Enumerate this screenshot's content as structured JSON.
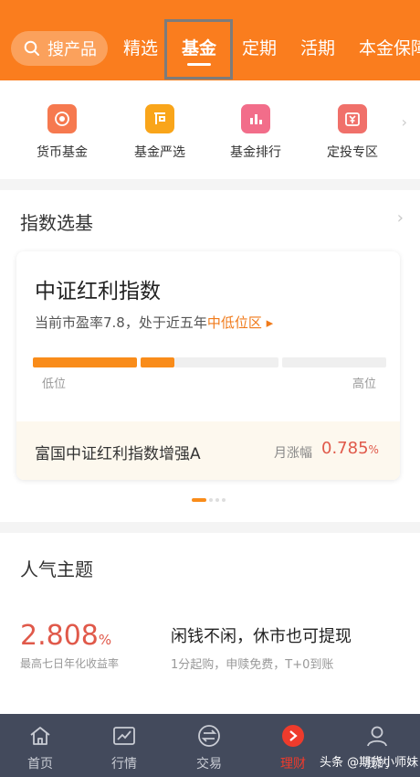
{
  "header": {
    "search_label": "搜产品",
    "tabs": [
      {
        "label": "精选"
      },
      {
        "label": "基金"
      },
      {
        "label": "定期"
      },
      {
        "label": "活期"
      },
      {
        "label": "本金保障"
      }
    ],
    "active_tab": "基金"
  },
  "quick_nav": [
    {
      "label": "货币基金",
      "icon": "target-icon"
    },
    {
      "label": "基金严选",
      "icon": "flag-icon"
    },
    {
      "label": "基金排行",
      "icon": "bar-chart-icon"
    },
    {
      "label": "定投专区",
      "icon": "yuan-calendar-icon"
    }
  ],
  "index_section": {
    "title": "指数选基",
    "card": {
      "title": "中证红利指数",
      "desc_prefix": "当前市盈率7.8，处于近五年",
      "desc_highlight": "中低位区",
      "low_label": "低位",
      "high_label": "高位",
      "valuation_position_fraction": 0.4,
      "fund_name": "富国中证红利指数增强A",
      "metric_label": "月涨幅",
      "metric_value": "0.785",
      "metric_unit": "%"
    },
    "pager": {
      "count": 4,
      "active_index": 0
    }
  },
  "popular_section": {
    "title": "人气主题",
    "value": "2.808",
    "value_unit": "%",
    "value_label": "最高七日年化收益率",
    "headline": "闲钱不闲，休市也可提现",
    "subline": "1分起购，申赎免费，T+0到账"
  },
  "bottom_nav": [
    {
      "label": "首页",
      "icon": "home-icon"
    },
    {
      "label": "行情",
      "icon": "chart-icon"
    },
    {
      "label": "交易",
      "icon": "exchange-icon"
    },
    {
      "label": "理财",
      "icon": "wealth-icon"
    },
    {
      "label": "我的",
      "icon": "user-icon"
    }
  ],
  "bottom_active": "理财",
  "watermark": "头条 @期货小师妹",
  "colors": {
    "brand_orange": "#fa7d1e",
    "accent_red": "#e0594a",
    "highlight_orange": "#f07a1a",
    "bottom_bar": "#434a5c",
    "active_nav": "#ee3b2c"
  }
}
